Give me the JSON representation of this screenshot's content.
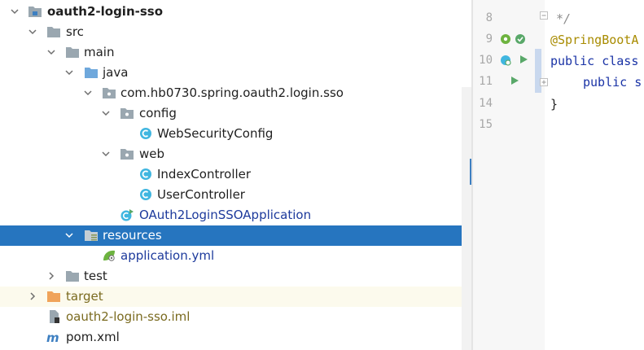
{
  "project_tree": {
    "rows": [
      {
        "label": "oauth2-login-sso",
        "icon": "module-folder-icon",
        "state": "expanded"
      },
      {
        "label": "src",
        "icon": "folder-icon",
        "state": "expanded"
      },
      {
        "label": "main",
        "icon": "folder-icon",
        "state": "expanded"
      },
      {
        "label": "java",
        "icon": "source-folder-icon",
        "state": "expanded"
      },
      {
        "label": "com.hb0730.spring.oauth2.login.sso",
        "icon": "package-icon",
        "state": "expanded"
      },
      {
        "label": "config",
        "icon": "package-icon",
        "state": "expanded"
      },
      {
        "label": "WebSecurityConfig",
        "icon": "class-icon",
        "state": "leaf"
      },
      {
        "label": "web",
        "icon": "package-icon",
        "state": "expanded"
      },
      {
        "label": "IndexController",
        "icon": "class-icon",
        "state": "leaf"
      },
      {
        "label": "UserController",
        "icon": "class-icon",
        "state": "leaf"
      },
      {
        "label": "OAuth2LoginSSOApplication",
        "icon": "spring-boot-class-icon",
        "state": "leaf"
      },
      {
        "label": "resources",
        "icon": "resources-folder-icon",
        "state": "expanded"
      },
      {
        "label": "application.yml",
        "icon": "spring-yml-icon",
        "state": "leaf"
      },
      {
        "label": "test",
        "icon": "folder-icon",
        "state": "collapsed"
      },
      {
        "label": "target",
        "icon": "excluded-folder-icon",
        "state": "collapsed"
      },
      {
        "label": "oauth2-login-sso.iml",
        "icon": "iml-file-icon",
        "state": "leaf"
      },
      {
        "label": "pom.xml",
        "icon": "maven-icon",
        "state": "leaf"
      }
    ],
    "selected": "resources"
  },
  "editor": {
    "line_numbers": [
      "8",
      "9",
      "10",
      "11",
      "14",
      "15"
    ],
    "lines": {
      "l8": "*/",
      "l9": "@SpringBootA",
      "l10_kw": "public",
      "l10_rest": " class",
      "l11_kw": "public",
      "l11_rest": " s",
      "l14": "}"
    },
    "colors": {
      "keyword": "#1a33a6",
      "annotation": "#a88b00",
      "selection": "#2675bf"
    }
  }
}
